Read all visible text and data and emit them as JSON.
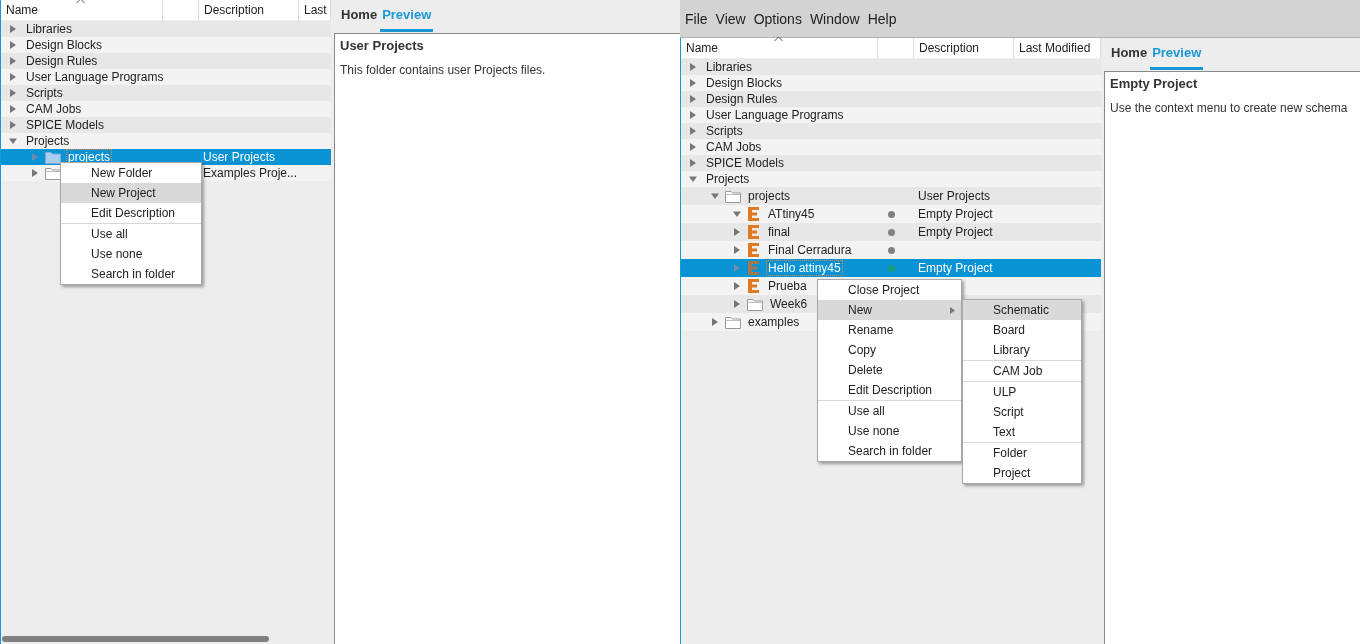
{
  "panels": [
    {
      "tree": {
        "columns": [
          {
            "kind": "name",
            "label": "Name",
            "sorted": true
          },
          {
            "kind": "status"
          },
          {
            "kind": "description",
            "label": "Description"
          },
          {
            "kind": "modified",
            "label": "Last"
          }
        ],
        "rows": [
          {
            "name": "Libraries",
            "kind": "category",
            "expanded": false,
            "selected": false
          },
          {
            "name": "Design Blocks",
            "kind": "category",
            "expanded": false,
            "selected": false
          },
          {
            "name": "Design Rules",
            "kind": "category",
            "expanded": false,
            "selected": false
          },
          {
            "name": "User Language Programs",
            "kind": "category",
            "expanded": false,
            "selected": false
          },
          {
            "name": "Scripts",
            "kind": "category",
            "expanded": false,
            "selected": false
          },
          {
            "name": "CAM Jobs",
            "kind": "category",
            "expanded": false,
            "selected": false
          },
          {
            "name": "SPICE Models",
            "kind": "category",
            "expanded": false,
            "selected": false
          },
          {
            "name": "Projects",
            "kind": "category",
            "expanded": true,
            "selected": false,
            "children": [
              {
                "name": "projects",
                "kind": "folder",
                "expanded": false,
                "selected": true,
                "description": "User Projects"
              },
              {
                "kind": "folder",
                "expanded": false,
                "selected": false,
                "description": "Examples Proje..."
              }
            ]
          }
        ]
      },
      "context_menu": {
        "sections": [
          {
            "items": [
              {
                "label": "New Folder",
                "selected": false
              },
              {
                "label": "New Project",
                "selected": true
              },
              {
                "label": "Edit Description",
                "selected": false
              }
            ]
          },
          {
            "items": [
              {
                "label": "Use all",
                "selected": false
              },
              {
                "label": "Use none",
                "selected": false
              },
              {
                "label": "Search in folder",
                "selected": false
              }
            ]
          }
        ]
      },
      "preview": {
        "tabs": [
          {
            "label": "Home",
            "selected": false
          },
          {
            "label": "Preview",
            "selected": true
          }
        ],
        "title": "User Projects",
        "text": "This folder contains user Projects files."
      }
    },
    {
      "menubar": [
        "File",
        "View",
        "Options",
        "Window",
        "Help"
      ],
      "tree": {
        "columns": [
          {
            "kind": "name",
            "label": "Name",
            "sorted": true
          },
          {
            "kind": "status"
          },
          {
            "kind": "description",
            "label": "Description"
          },
          {
            "kind": "modified",
            "label": "Last Modified"
          }
        ],
        "rows": [
          {
            "name": "Libraries",
            "kind": "category",
            "expanded": false,
            "selected": false
          },
          {
            "name": "Design Blocks",
            "kind": "category",
            "expanded": false,
            "selected": false
          },
          {
            "name": "Design Rules",
            "kind": "category",
            "expanded": false,
            "selected": false
          },
          {
            "name": "User Language Programs",
            "kind": "category",
            "expanded": false,
            "selected": false
          },
          {
            "name": "Scripts",
            "kind": "category",
            "expanded": false,
            "selected": false
          },
          {
            "name": "CAM Jobs",
            "kind": "category",
            "expanded": false,
            "selected": false
          },
          {
            "name": "SPICE Models",
            "kind": "category",
            "expanded": false,
            "selected": false
          },
          {
            "name": "Projects",
            "kind": "category",
            "expanded": true,
            "selected": false,
            "children": [
              {
                "name": "projects",
                "kind": "folder",
                "expanded": true,
                "selected": false,
                "description": "User Projects",
                "children": [
                  {
                    "name": "ATtiny45",
                    "kind": "project",
                    "expanded": true,
                    "selected": false,
                    "color": "#808080",
                    "description": "Empty Project"
                  },
                  {
                    "name": "final",
                    "kind": "project",
                    "expanded": false,
                    "selected": false,
                    "color": "#808080",
                    "description": "Empty Project"
                  },
                  {
                    "name": "Final Cerradura",
                    "kind": "project",
                    "expanded": false,
                    "selected": false,
                    "color": "#808080"
                  },
                  {
                    "name": "Hello attiny45",
                    "kind": "project",
                    "expanded": false,
                    "selected": true,
                    "color": "#1a9e78",
                    "description": "Empty Project"
                  },
                  {
                    "name": "Prueba",
                    "kind": "project",
                    "expanded": false,
                    "selected": false
                  },
                  {
                    "name": "Week6",
                    "kind": "folder",
                    "expanded": false,
                    "selected": false
                  }
                ]
              },
              {
                "name": "examples",
                "kind": "folder",
                "expanded": false,
                "selected": false
              }
            ]
          }
        ]
      },
      "context_menu": {
        "sections": [
          {
            "items": [
              {
                "label": "Close Project",
                "selected": false
              },
              {
                "label": "New",
                "selected": true,
                "submenu": {
                  "sections": [
                    {
                      "items": [
                        {
                          "label": "Schematic",
                          "selected": true
                        },
                        {
                          "label": "Board",
                          "selected": false
                        },
                        {
                          "label": "Library",
                          "selected": false
                        }
                      ]
                    },
                    {
                      "items": [
                        {
                          "label": "CAM Job",
                          "selected": false
                        }
                      ]
                    },
                    {
                      "items": [
                        {
                          "label": "ULP",
                          "selected": false
                        },
                        {
                          "label": "Script",
                          "selected": false
                        },
                        {
                          "label": "Text",
                          "selected": false
                        }
                      ]
                    },
                    {
                      "items": [
                        {
                          "label": "Folder",
                          "selected": false
                        },
                        {
                          "label": "Project",
                          "selected": false
                        }
                      ]
                    }
                  ]
                }
              },
              {
                "label": "Rename",
                "selected": false
              },
              {
                "label": "Copy",
                "selected": false
              },
              {
                "label": "Delete",
                "selected": false
              },
              {
                "label": "Edit Description",
                "selected": false
              }
            ]
          },
          {
            "items": [
              {
                "label": "Use all",
                "selected": false
              },
              {
                "label": "Use none",
                "selected": false
              },
              {
                "label": "Search in folder",
                "selected": false
              }
            ]
          }
        ]
      },
      "preview": {
        "tabs": [
          {
            "label": "Home",
            "selected": false
          },
          {
            "label": "Preview",
            "selected": true
          }
        ],
        "title": "Empty Project",
        "text": "Use the context menu to create new schema"
      }
    }
  ]
}
